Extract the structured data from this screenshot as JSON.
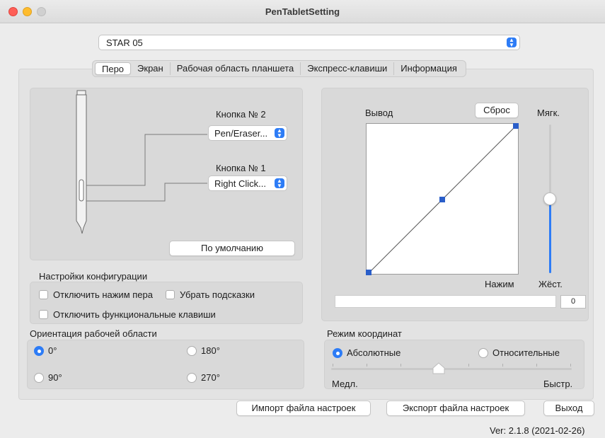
{
  "window": {
    "title": "PenTabletSetting"
  },
  "device": {
    "selected": "STAR 05"
  },
  "tabs": [
    {
      "label": "Перо",
      "active": true
    },
    {
      "label": "Экран",
      "active": false
    },
    {
      "label": "Рабочая область планшета",
      "active": false
    },
    {
      "label": "Экспресс-клавиши",
      "active": false
    },
    {
      "label": "Информация",
      "active": false
    }
  ],
  "pen": {
    "button2": {
      "label": "Кнопка № 2",
      "value": "Pen/Eraser..."
    },
    "button1": {
      "label": "Кнопка № 1",
      "value": "Right Click..."
    },
    "default_button": "По умолчанию"
  },
  "config": {
    "title": "Настройки конфигурации",
    "disable_pen_press": "Отключить нажим пера",
    "hide_hints": "Убрать подсказки",
    "disable_function_keys": "Отключить функциональные клавиши"
  },
  "orientation": {
    "title": "Ориентация рабочей области",
    "options": [
      "0°",
      "180°",
      "90°",
      "270°"
    ],
    "selected": "0°"
  },
  "pressure": {
    "output_label": "Вывод",
    "reset_button": "Сброс",
    "soft_label": "Мягк.",
    "hard_label": "Жёст.",
    "press_label": "Нажим",
    "press_value": "0",
    "sensitivity_level": 0.5
  },
  "coords": {
    "title": "Режим координат",
    "absolute": "Абсолютные",
    "relative": "Относительные",
    "selected": "Абсолютные",
    "slow": "Медл.",
    "fast": "Быстр.",
    "speed_level": 0.45
  },
  "footer": {
    "import": "Импорт файла настроек",
    "export": "Экспорт файла настроек",
    "exit": "Выход",
    "version": "Ver: 2.1.8 (2021-02-26)"
  },
  "colors": {
    "accent": "#2d7cf6",
    "handle": "#2a5ec9"
  }
}
